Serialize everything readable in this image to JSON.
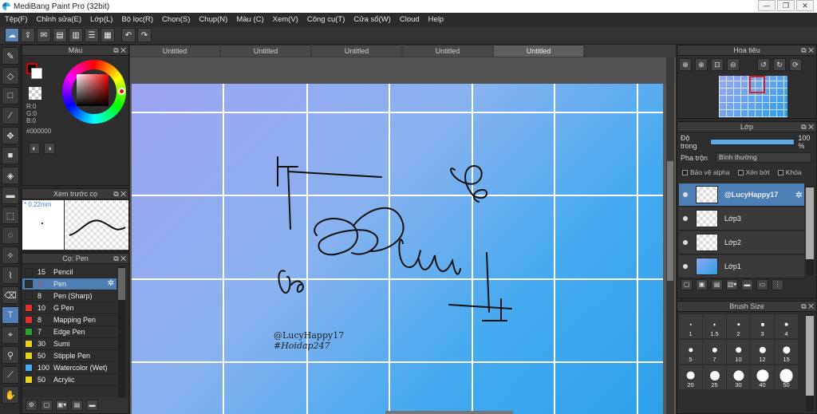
{
  "window": {
    "title": "MediBang Paint Pro (32bit)",
    "minimize": "—",
    "maximize": "❐",
    "close": "✕"
  },
  "menu": [
    "Tệp(F)",
    "Chỉnh sửa(E)",
    "Lớp(L)",
    "Bộ lọc(R)",
    "Chọn(S)",
    "Chụp(N)",
    "Màu (C)",
    "Xem(V)",
    "Công cụ(T)",
    "Cửa sổ(W)",
    "Cloud",
    "Help"
  ],
  "toolbar_icons": [
    "cloud-icon",
    "share-icon",
    "comment-icon",
    "page-icon",
    "layout-icon",
    "grid-icon",
    "undo-icon",
    "redo-icon"
  ],
  "color_panel": {
    "title": "Màu",
    "r": "R:0",
    "g": "G:0",
    "b": "B:0",
    "hex": "#000000",
    "fg_color": "#000000",
    "bg_color": "#ffffff"
  },
  "preview_panel": {
    "title": "Xem trước cọ",
    "size": "0.22mm"
  },
  "brush_panel": {
    "title": "Cọ: Pen",
    "items": [
      {
        "num": "15",
        "name": "Pencil",
        "color": "#2e2e2e"
      },
      {
        "num": "3",
        "name": "Pen",
        "color": "#2e2e2e",
        "selected": true
      },
      {
        "num": "8",
        "name": "Pen (Sharp)",
        "color": "#2e2e2e"
      },
      {
        "num": "10",
        "name": "G Pen",
        "color": "#e03030"
      },
      {
        "num": "8",
        "name": "Mapping Pen",
        "color": "#e03030"
      },
      {
        "num": "7",
        "name": "Edge Pen",
        "color": "#2ea02e"
      },
      {
        "num": "30",
        "name": "Sumi",
        "color": "#e8d020"
      },
      {
        "num": "50",
        "name": "Stipple Pen",
        "color": "#e8d020"
      },
      {
        "num": "100",
        "name": "Watercolor (Wet)",
        "color": "#40b0f0"
      },
      {
        "num": "50",
        "name": "Acrylic",
        "color": "#e8d020"
      }
    ]
  },
  "tabs": [
    "Untitled",
    "Untitled",
    "Untitled",
    "Untitled",
    "Untitled"
  ],
  "canvas": {
    "signature1": "@LucyHappy17",
    "signature2": "#Hoidap247"
  },
  "navigator": {
    "title": "Hoa tiêu"
  },
  "layers": {
    "title": "Lớp",
    "opacity_label": "Độ trong",
    "opacity_value": "100 %",
    "blend_label": "Pha trộn",
    "blend_value": "Bình thường",
    "chk_alpha": "Bảo vệ alpha",
    "chk_clip": "Xén bớt",
    "chk_lock": "Khóa",
    "items": [
      {
        "name": "@LucyHappy17",
        "selected": true
      },
      {
        "name": "Lớp3"
      },
      {
        "name": "Lớp2"
      },
      {
        "name": "Lớp1"
      }
    ]
  },
  "brush_size": {
    "title": "Brush Size",
    "sizes": [
      "1",
      "1.5",
      "2",
      "3",
      "4",
      "5",
      "7",
      "10",
      "12",
      "15",
      "20",
      "25",
      "30",
      "40",
      "50"
    ]
  }
}
